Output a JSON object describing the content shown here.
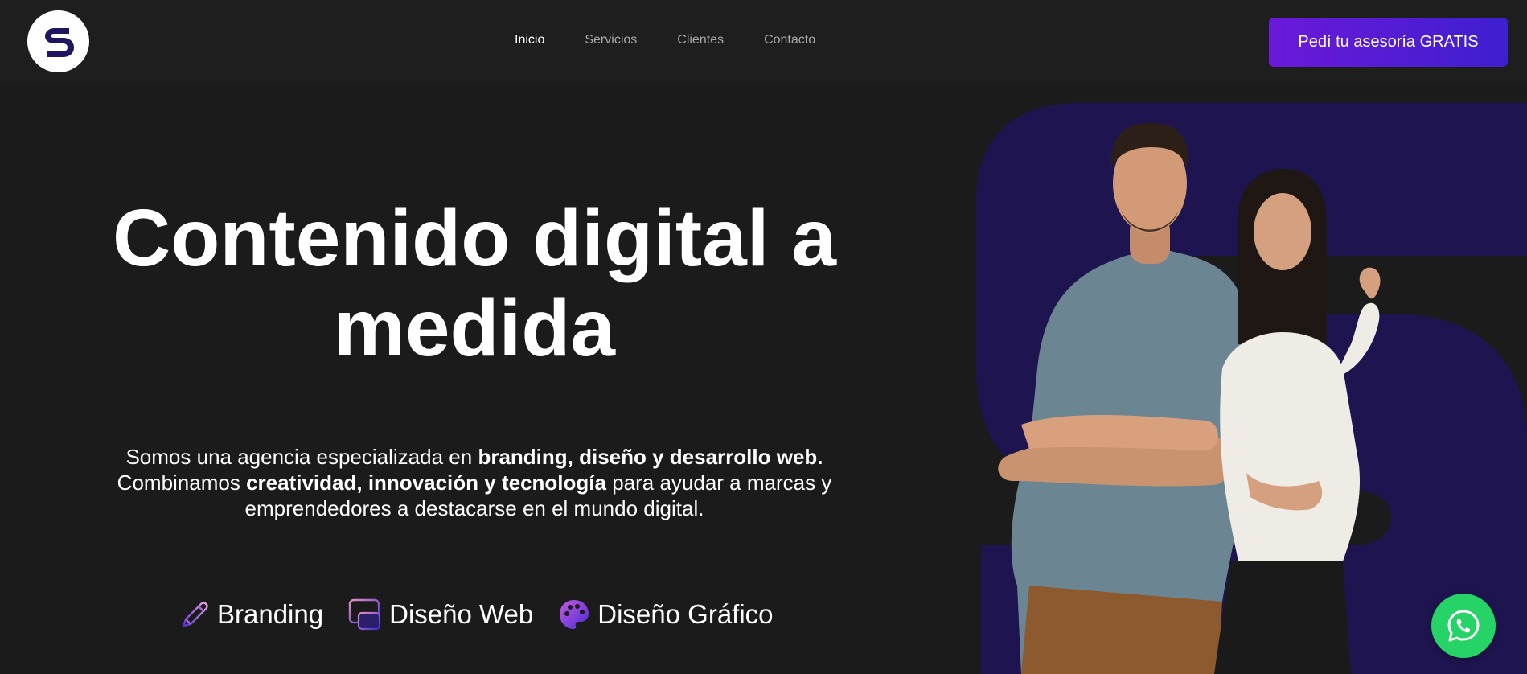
{
  "header": {
    "logo_alt": "S",
    "nav": [
      {
        "label": "Inicio",
        "active": true
      },
      {
        "label": "Servicios",
        "active": false
      },
      {
        "label": "Clientes",
        "active": false
      },
      {
        "label": "Contacto",
        "active": false
      }
    ],
    "cta_label": "Pedí tu asesoría GRATIS"
  },
  "hero": {
    "title_line1": "Contenido digital a",
    "title_line2": "medida",
    "desc": {
      "p1_a": "Somos una agencia especializada en ",
      "p1_b": "branding, diseño y desarrollo web.",
      "p2_a": "Combinamos ",
      "p2_b": "creatividad, innovación y tecnología",
      "p2_c": " para ayudar a marcas y emprendedores a destacarse en el mundo digital."
    },
    "services": [
      {
        "label": "Branding",
        "icon": "pen-icon"
      },
      {
        "label": "Diseño Web",
        "icon": "browser-icon"
      },
      {
        "label": "Diseño Gráfico",
        "icon": "palette-icon"
      }
    ]
  },
  "colors": {
    "background": "#1b1b1c",
    "header": "#1e1e1f",
    "cta_from": "#6b19d8",
    "cta_to": "#3e1fcf",
    "accent_shape": "#1e1550",
    "whatsapp": "#25d366"
  },
  "floating": {
    "icon": "whatsapp-icon"
  }
}
